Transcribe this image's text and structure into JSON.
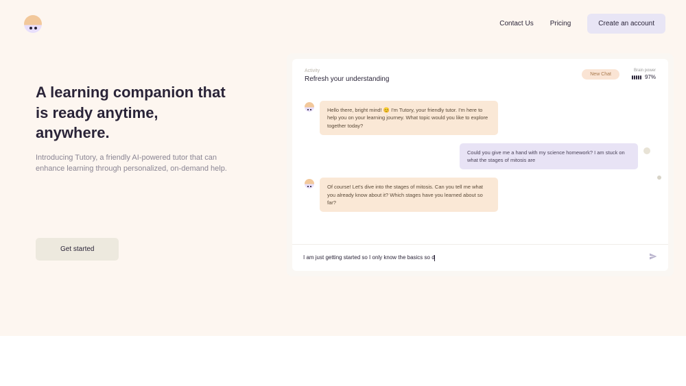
{
  "nav": {
    "contact": "Contact Us",
    "pricing": "Pricing",
    "create_account": "Create an account"
  },
  "hero": {
    "title": "A learning companion that is ready anytime, anywhere.",
    "subtitle": "Introducing Tutory, a friendly AI-powered tutor that can enhance learning through personalized, on-demand help.",
    "cta": "Get started"
  },
  "chat": {
    "activity_label": "Activity",
    "activity_title": "Refresh your understanding",
    "new_chat": "New Chat",
    "brain_label": "Brain power",
    "brain_pct": "97%",
    "messages": {
      "ai1": "Hello there, bright mind! 😊 I'm Tutory, your friendly tutor. I'm here to help you on your learning journey. What topic would you like to explore together today?",
      "user1": "Could you give me a hand with my science homework? I am stuck on what the stages of mitosis are",
      "ai2": "Of course! Let's dive into the stages of mitosis. Can you tell me what you already know about it? Which stages have you learned about so far?"
    },
    "input_value": "I am just getting started so I only know the basics so d"
  }
}
